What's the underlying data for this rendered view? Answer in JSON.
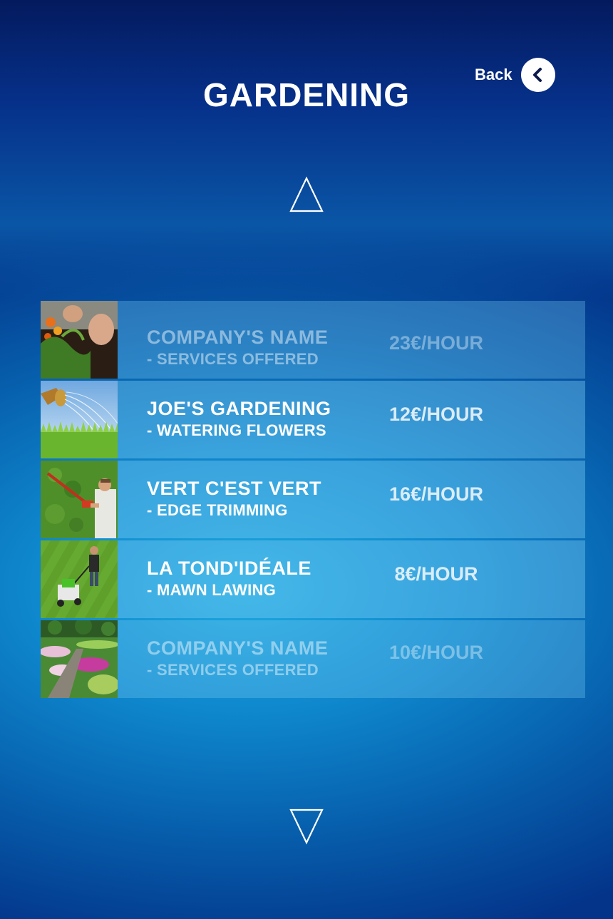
{
  "header": {
    "title": "GARDENING",
    "back_label": "Back"
  },
  "icons": {
    "back": "chevron-left-icon",
    "scroll_up": "triangle-up-icon",
    "scroll_down": "triangle-down-icon"
  },
  "colors": {
    "background_top": "#041a5e",
    "background_mid": "#1fa9df",
    "row_fill": "#78cdf5",
    "text": "#ffffff"
  },
  "list": {
    "items": [
      {
        "name": "COMPANY'S NAME",
        "service": "- SERVICES OFFERED",
        "price": "23€/HOUR"
      },
      {
        "name": "JOE'S GARDENING",
        "service": "- WATERING FLOWERS",
        "price": "12€/HOUR"
      },
      {
        "name": "VERT C'EST VERT",
        "service": "- EDGE TRIMMING",
        "price": "16€/HOUR"
      },
      {
        "name": "LA TOND'IDÉALE",
        "service": "- MAWN LAWING",
        "price": "8€/HOUR"
      },
      {
        "name": "COMPANY'S NAME",
        "service": "- SERVICES OFFERED",
        "price": "10€/HOUR"
      }
    ]
  }
}
